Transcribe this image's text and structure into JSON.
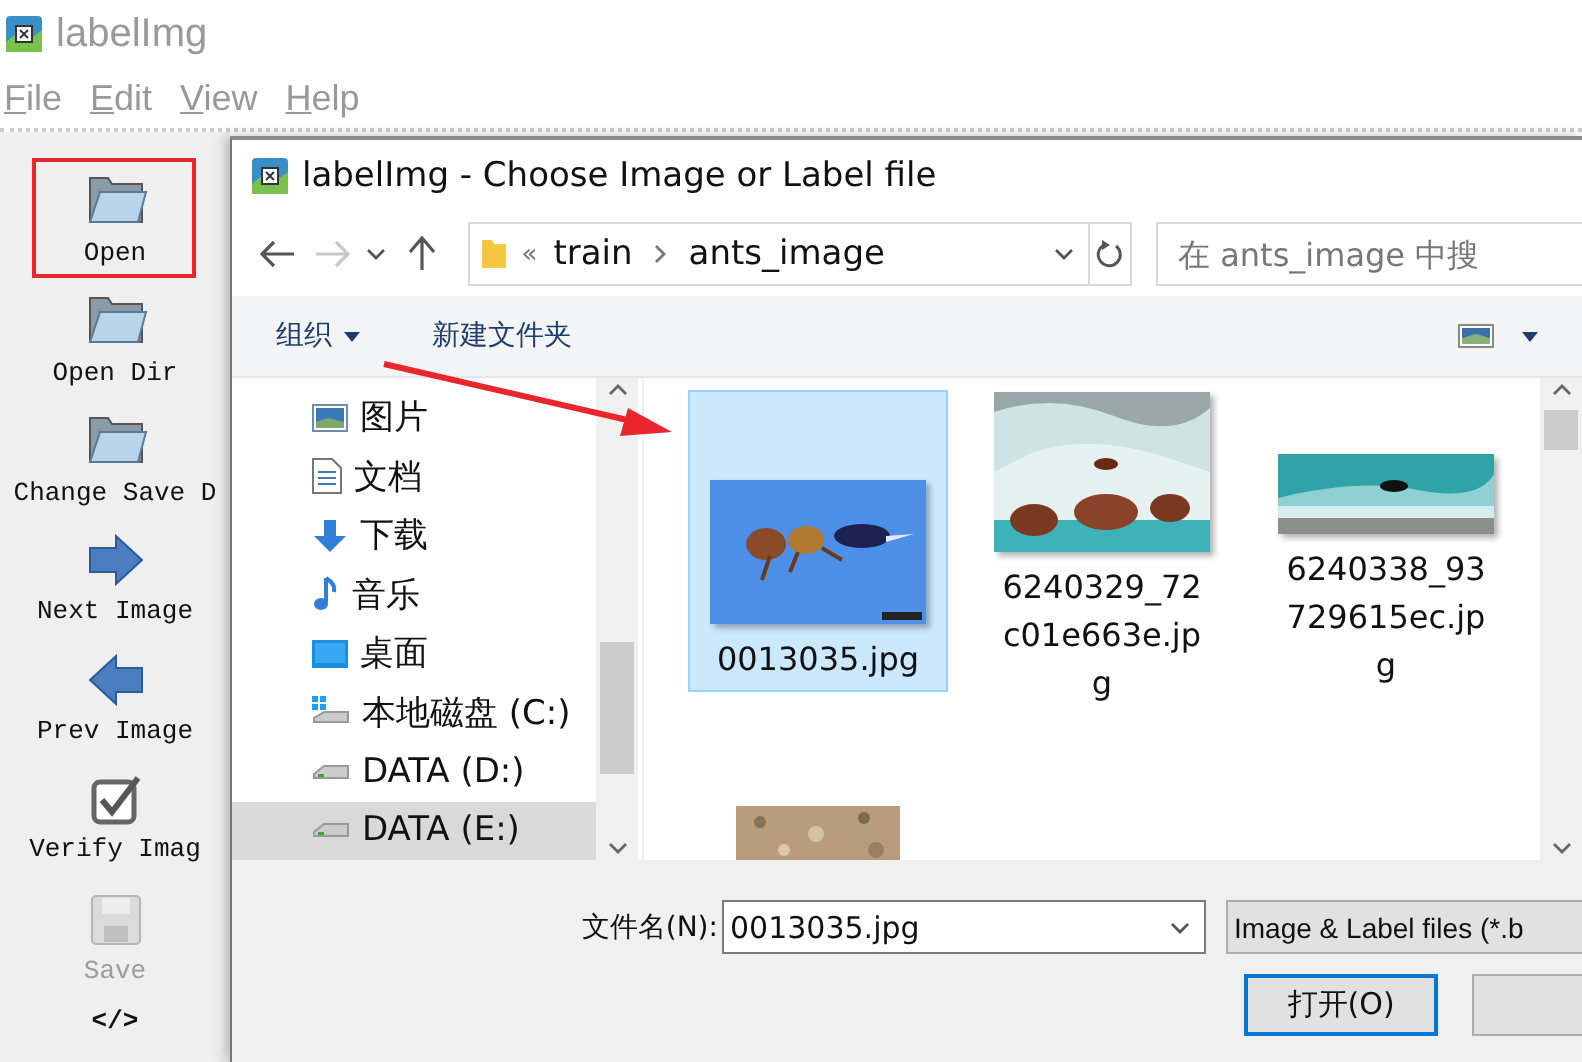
{
  "app": {
    "title": "labelImg"
  },
  "menu": [
    {
      "label": "File"
    },
    {
      "label": "Edit"
    },
    {
      "label": "View"
    },
    {
      "label": "Help"
    }
  ],
  "toolbar": [
    {
      "label": "Open",
      "kind": "folder",
      "highlighted": true,
      "disabled": false
    },
    {
      "label": "Open Dir",
      "kind": "folder",
      "highlighted": false,
      "disabled": false
    },
    {
      "label": "Change Save D",
      "kind": "folder",
      "highlighted": false,
      "disabled": false
    },
    {
      "label": "Next Image",
      "kind": "next",
      "highlighted": false,
      "disabled": false
    },
    {
      "label": "Prev Image",
      "kind": "prev",
      "highlighted": false,
      "disabled": false
    },
    {
      "label": "Verify Imag",
      "kind": "verify",
      "highlighted": false,
      "disabled": false
    },
    {
      "label": "Save",
      "kind": "save",
      "highlighted": false,
      "disabled": true
    },
    {
      "label": "</>",
      "kind": "text"
    }
  ],
  "dialog": {
    "title": "labelImg - Choose Image or Label file",
    "overflow_mark": "«",
    "path": [
      "train",
      "ants_image"
    ],
    "search": {
      "placeholder": "在 ants_image 中搜"
    },
    "commands": [
      {
        "label": "组织",
        "menu": true
      },
      {
        "label": "新建文件夹",
        "menu": false
      }
    ],
    "nav_pane": [
      {
        "label": "图片",
        "kind": "pictures",
        "selected": false
      },
      {
        "label": "文档",
        "kind": "documents",
        "selected": false
      },
      {
        "label": "下载",
        "kind": "downloads",
        "selected": false
      },
      {
        "label": "音乐",
        "kind": "music",
        "selected": false
      },
      {
        "label": "桌面",
        "kind": "desktop",
        "selected": false
      },
      {
        "label": "本地磁盘 (C:)",
        "kind": "system-drive",
        "selected": false
      },
      {
        "label": "DATA (D:)",
        "kind": "drive",
        "selected": false
      },
      {
        "label": "DATA (E:)",
        "kind": "drive",
        "selected": true
      }
    ],
    "files": [
      {
        "name": "0013035.jpg",
        "selected": true
      },
      {
        "name": "6240329_72c01e663e.jpg",
        "selected": false
      },
      {
        "name": "6240338_93729615ec.jpg",
        "selected": false
      },
      {
        "selected": false
      }
    ],
    "filename_label": "文件名(N):",
    "filename": "0013035.jpg",
    "filter": "Image & Label files (*.b",
    "open_button": "打开(O)"
  },
  "annotation": {
    "arrow": true
  }
}
